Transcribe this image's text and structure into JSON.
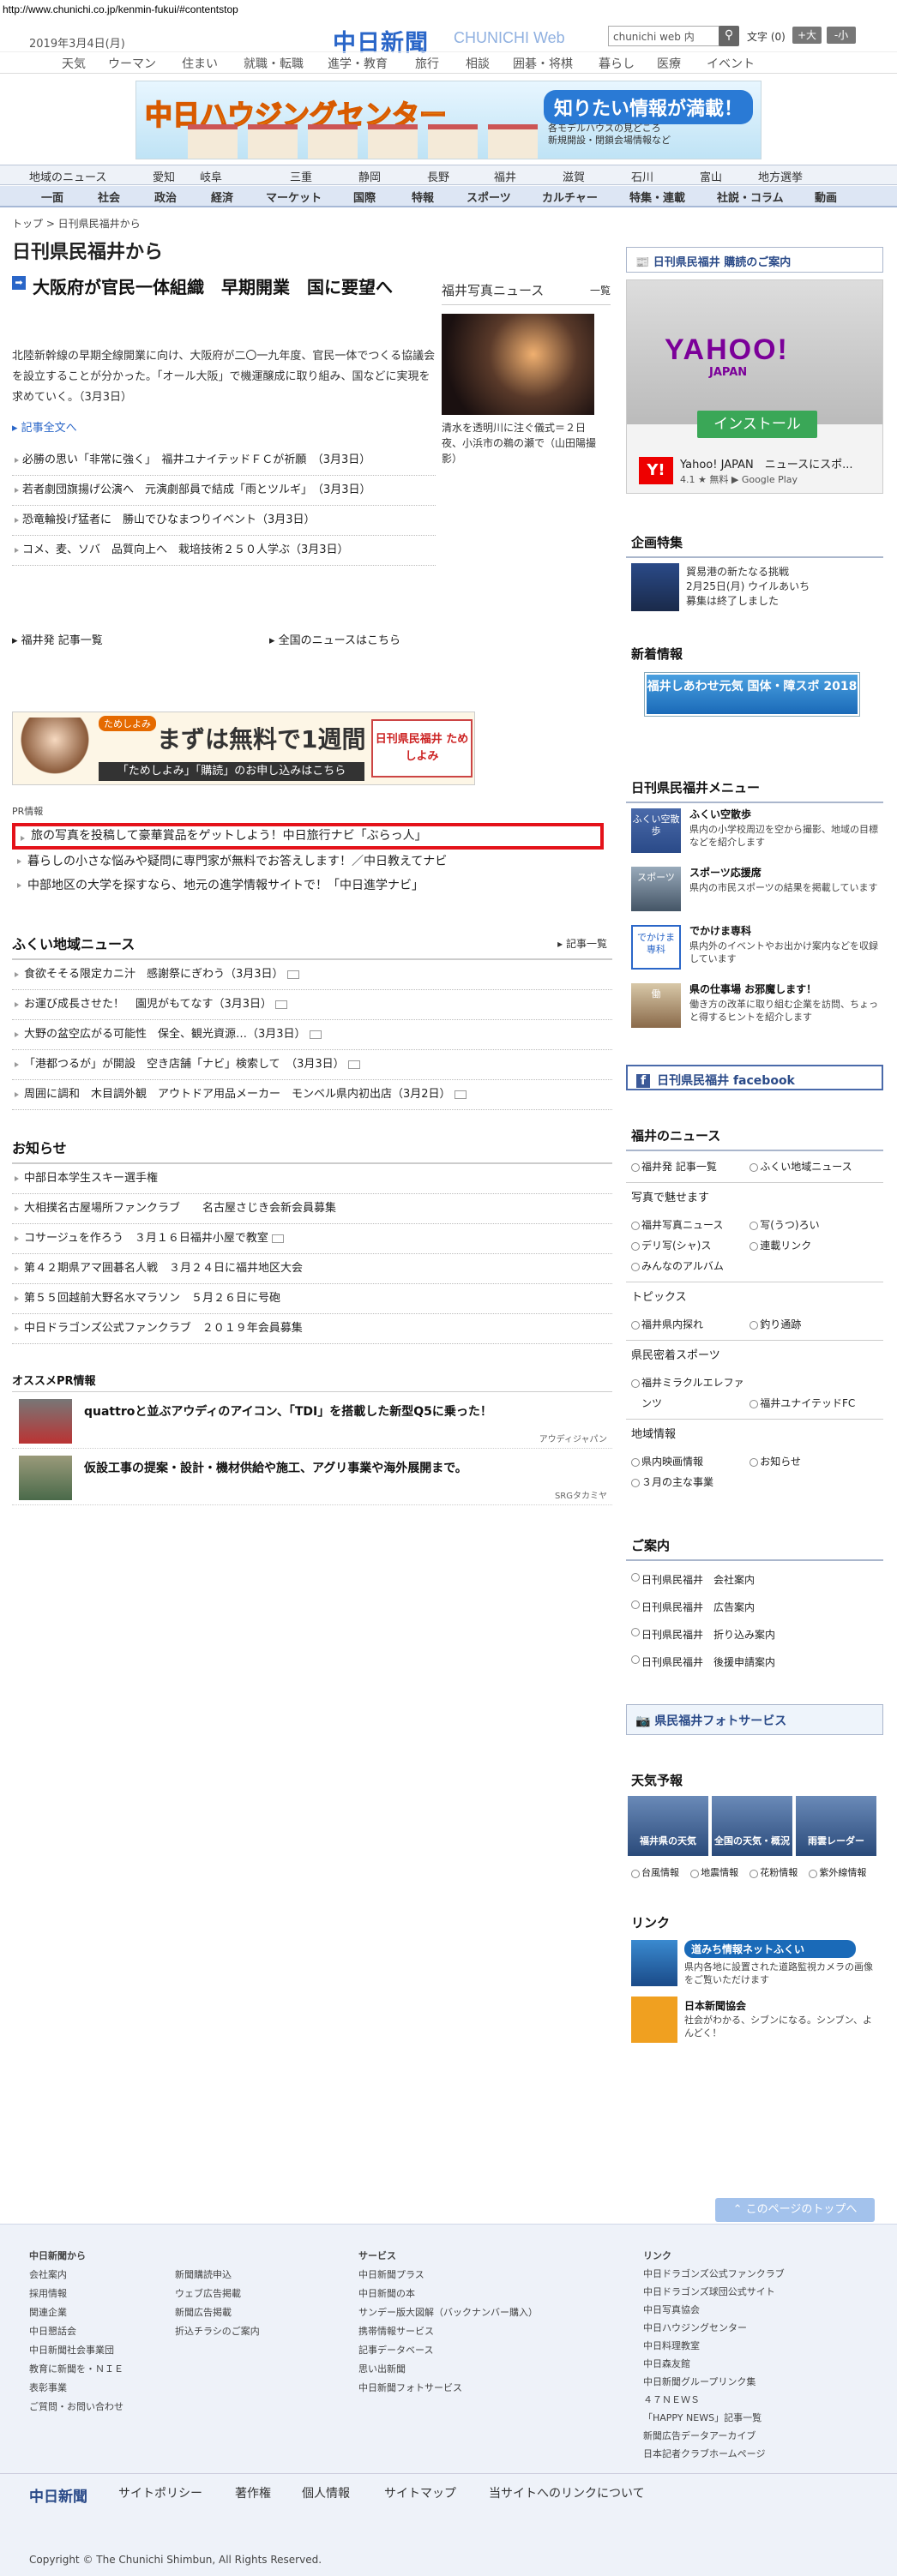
{
  "url": "http://www.chunichi.co.jp/kenmin-fukui/#contentstop",
  "header": {
    "date": "2019年3月4日(月)",
    "logo": "中日新聞",
    "logo_sub": "CHUNICHI Web",
    "search_placeholder": "chunichi web 内",
    "font_label": "文字 (0)",
    "font_big": "+大",
    "font_small": "-小"
  },
  "gnav": [
    "天気",
    "ウーマン",
    "住まい",
    "就職・転職",
    "進学・教育",
    "旅行",
    "相談",
    "囲碁・将棋",
    "暮らし",
    "医療",
    "イベント"
  ],
  "banner": {
    "title": "中日ハウジングセンター",
    "catch": "知りたい情報が満載！",
    "sub1": "各モデルハウスの見どころ",
    "sub2": "新規開設・閉鎖会場情報など"
  },
  "rnav": [
    "地域のニュース",
    "愛知",
    "岐阜",
    "三重",
    "静岡",
    "長野",
    "福井",
    "滋賀",
    "石川",
    "富山",
    "地方選挙"
  ],
  "cnav": [
    "一面",
    "社会",
    "政治",
    "経済",
    "マーケット",
    "国際",
    "特報",
    "スポーツ",
    "カルチャー",
    "特集・連載",
    "社説・コラム",
    "動画"
  ],
  "breadcrumb": "トップ > 日刊県民福井から",
  "page_title": "日刊県民福井から",
  "lead": {
    "headline": "大阪府が官民一体組織　早期開業　国に要望へ",
    "body": "北陸新幹線の早期全線開業に向け、大阪府が二〇一九年度、官民一体でつくる協議会を設立することが分かった。「オール大阪」で機運醸成に取り組み、国などに実現を求めていく。（3月3日）",
    "more": "記事全文へ"
  },
  "news": [
    "必勝の思い「非常に強く」　福井ユナイテッドＦＣが祈願　（3月3日）",
    "若者劇団旗揚げ公演へ　元演劇部員で結成「雨とツルギ」　（3月3日）",
    "恐竜輪投げ猛者に　勝山でひなまつりイベント（3月3日）",
    "コメ、麦、ソバ　品質向上へ　栽培技術２５０人学ぶ（3月3日）"
  ],
  "photo": {
    "heading": "福井写真ニュース",
    "list": "一覧",
    "caption": "清水を透明川に注ぐ儀式＝２日夜、小浜市の鵜の瀬で（山田陽撮影）"
  },
  "links": {
    "fukui_list": "福井発 記事一覧",
    "all_news": "全国のニュースはこちら"
  },
  "ad2": {
    "brand": "ためしよみ",
    "free": "まずは無料で1週間",
    "bar": "「ためしよみ」「購読」のお申し込みはこちら",
    "logo": "日刊県民福井 ためしよみ"
  },
  "pr": {
    "label": "PR情報",
    "items": [
      "旅の写真を投稿して豪華賞品をゲットしよう！中日旅行ナビ「ぶらっ人」",
      "暮らしの小さな悩みや疑問に専門家が無料でお答えします！／中日教えてナビ",
      "中部地区の大学を探すなら、地元の進学情報サイトで！「中日進学ナビ」"
    ]
  },
  "local": {
    "title": "ふくい地域ニュース",
    "list": "記事一覧",
    "items": [
      "食欲そそる限定カニ汁　感謝祭にぎわう（3月3日）",
      "お運び成長させた！　園児がもてなす（3月3日）",
      "大野の盆空広がる可能性　保全、観光資源…（3月3日）",
      "「港都つるが」が開設　空き店舗「ナビ」検索して　（3月3日）",
      "周囲に調和　木目調外観　アウトドア用品メーカー　モンベル県内初出店（3月2日）"
    ]
  },
  "notice": {
    "title": "お知らせ",
    "items": [
      "中部日本学生スキー選手権",
      "大相撲名古屋場所ファンクラブ　　名古屋さじき会新会員募集",
      "コサージュを作ろう　３月１６日福井小屋で教室",
      "第４２期県アマ囲碁名人戦　３月２４日に福井地区大会",
      "第５５回越前大野名水マラソン　５月２６日に号砲",
      "中日ドラゴンズ公式ファンクラブ　２０１９年会員募集"
    ]
  },
  "osusume": {
    "title": "オススメPR情報",
    "items": [
      {
        "t": "quattroと並ぶアウディのアイコン、「TDI」を搭載した新型Q5に乗った！",
        "s": "アウディジャパン"
      },
      {
        "t": "仮設工事の提案・設計・機材供給や施工、アグリ事業や海外展開まで。",
        "s": "SRGタカミヤ"
      }
    ]
  },
  "side": {
    "subscribe": "日刊県民福井 購読のご案内",
    "yt": {
      "brand": "YAHOO!",
      "japan": "JAPAN",
      "install": "インストール",
      "name": "Yahoo! JAPAN　ニュースにスポ...",
      "rating": "4.1 ★ 無料",
      "store": "Google Play"
    },
    "kikaku": {
      "title": "企画特集",
      "text1": "貿易港の新たなる挑戦",
      "text2": "2月25日(月) ウイルあいち",
      "text3": "募集は終了しました"
    },
    "shinchaku": {
      "title": "新着情報",
      "banner": "福井しあわせ元気 国体・障スポ 2018"
    },
    "menu": {
      "title": "日刊県民福井メニュー",
      "items": [
        {
          "icon": "ふくい空散歩",
          "h": "ふくい空散歩",
          "d": "県内の小学校周辺を空から撮影、地域の目標などを紹介します"
        },
        {
          "icon": "スポーツ",
          "h": "スポーツ応援席",
          "d": "県内の市民スポーツの結果を掲載しています"
        },
        {
          "icon": "でかけま専科",
          "h": "でかけま専科",
          "d": "県内外のイベントやお出かけ案内などを収録しています"
        },
        {
          "icon": "働",
          "h": "県の仕事場 お邪魔します！",
          "d": "働き方の改革に取り組む企業を訪問、ちょっと得するヒントを紹介します"
        }
      ]
    },
    "facebook": "日刊県民福井 facebook",
    "fukui": {
      "title": "福井のニュース",
      "top": [
        "福井発 記事一覧",
        "ふくい地域ニュース"
      ],
      "photo_h": "写真で魅せます",
      "photo": [
        "福井写真ニュース",
        "写(うつ)ろい",
        "デリ写(シャ)ス",
        "連載リンク",
        "みんなのアルバム"
      ],
      "topics_h": "トピックス",
      "topics": [
        "福井県内探れ",
        "釣り通跡"
      ],
      "sports_h": "県民密着スポーツ",
      "sports": [
        "福井ミラクルエレファンツ",
        "福井ユナイテッドFC"
      ],
      "region_h": "地域情報",
      "region": [
        "県内映画情報",
        "お知らせ",
        "３月の主な事業"
      ]
    },
    "guide": {
      "title": "ご案内",
      "items": [
        "日刊県民福井　会社案内",
        "日刊県民福井　広告案内",
        "日刊県民福井　折り込み案内",
        "日刊県民福井　後援申請案内"
      ]
    },
    "photoservice": "県民福井フォトサービス",
    "weather": {
      "title": "天気予報",
      "boxes": [
        "福井県の天気",
        "全国の天気・概況",
        "雨雲レーダー"
      ],
      "links": [
        "台風情報",
        "地震情報",
        "花粉情報",
        "紫外線情報"
      ]
    },
    "link": {
      "title": "リンク",
      "items": [
        {
          "h": "道みち情報ネットふくい",
          "d": "県内各地に設置された道路監視カメラの画像をご覧いただけます"
        },
        {
          "h": "日本新聞協会",
          "d": "社会がわかる、シブンになる。シンブン、よんどく！"
        }
      ]
    }
  },
  "totop": "このページのトップへ",
  "footer": {
    "col1": {
      "h": "中日新聞から",
      "items": [
        "会社案内",
        "採用情報",
        "関連企業",
        "中日懇話会",
        "中日新聞社会事業団",
        "教育に新聞を・ＮＩＥ",
        "表彰事業",
        "ご質問・お問い合わせ"
      ]
    },
    "col2": {
      "items": [
        "新聞購読申込",
        "ウェブ広告掲載",
        "新聞広告掲載",
        "折込チラシのご案内"
      ]
    },
    "col3": {
      "h": "サービス",
      "items": [
        "中日新聞プラス",
        "中日新聞の本",
        "サンデー版大図解（バックナンバー購入）",
        "携帯情報サービス",
        "記事データベース",
        "思い出新聞",
        "中日新聞フォトサービス"
      ]
    },
    "col4": {
      "h": "リンク",
      "items": [
        "中日ドラゴンズ公式ファンクラブ",
        "中日ドラゴンズ球団公式サイト",
        "中日写真協会",
        "中日ハウジングセンター",
        "中日料理教室",
        "中日森友館",
        "中日新聞グループリンク集",
        "４７ＮＥＷＳ",
        "「HAPPY NEWS」記事一覧",
        "新聞広告データアーカイブ",
        "日本記者クラブホームページ"
      ]
    },
    "bar": [
      "中日新聞",
      "サイトポリシー",
      "著作権",
      "個人情報",
      "サイトマップ",
      "当サイトへのリンクについて"
    ],
    "copyright": "Copyright © The Chunichi Shimbun, All Rights Reserved."
  }
}
